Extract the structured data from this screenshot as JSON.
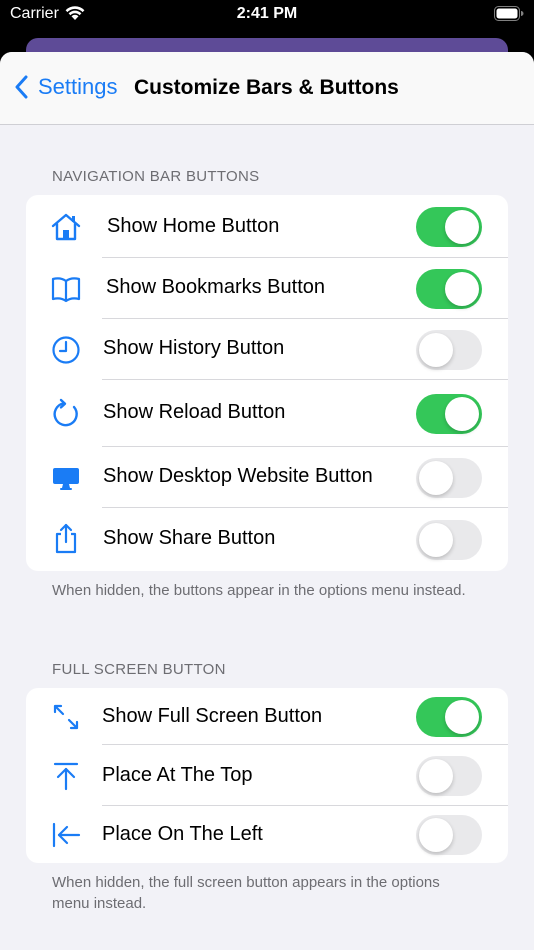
{
  "status_bar": {
    "carrier": "Carrier",
    "time": "2:41 PM"
  },
  "nav": {
    "back_label": "Settings",
    "title": "Customize Bars & Buttons"
  },
  "nav_section": {
    "header": "NAVIGATION BAR BUTTONS",
    "items": [
      {
        "label": "Show Home Button",
        "icon": "home-icon",
        "on": true
      },
      {
        "label": "Show Bookmarks Button",
        "icon": "book-icon",
        "on": true
      },
      {
        "label": "Show History Button",
        "icon": "clock-icon",
        "on": false
      },
      {
        "label": "Show Reload Button",
        "icon": "reload-icon",
        "on": true
      },
      {
        "label": "Show Desktop Website Button",
        "icon": "desktop-icon",
        "on": false
      },
      {
        "label": "Show Share Button",
        "icon": "share-icon",
        "on": false
      }
    ],
    "footer": "When hidden, the buttons appear in the options menu instead."
  },
  "fullscreen_section": {
    "header": "FULL SCREEN BUTTON",
    "items": [
      {
        "label": "Show Full Screen Button",
        "icon": "expand-icon",
        "on": true
      },
      {
        "label": "Place At The Top",
        "icon": "arrow-up-to-line-icon",
        "on": false
      },
      {
        "label": "Place On The Left",
        "icon": "arrow-left-to-line-icon",
        "on": false
      }
    ],
    "footer": "When hidden, the full screen button appears in the options menu instead."
  },
  "colors": {
    "accent": "#1a7cf5",
    "toggle_on": "#34c759",
    "toggle_off": "#e9e9eb",
    "background": "#f2f2f7"
  }
}
